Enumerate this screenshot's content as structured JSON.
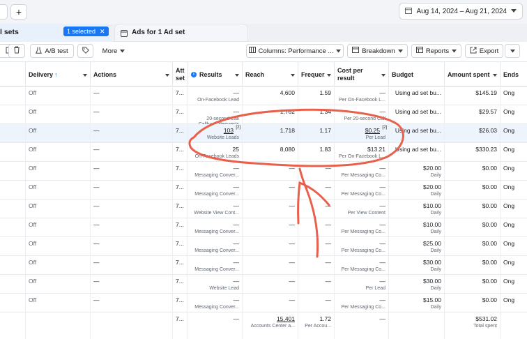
{
  "top": {
    "add_btn": "+",
    "date_range": "Aug 14, 2024 – Aug 21, 2024"
  },
  "tabs": {
    "adsets_label": "l sets",
    "selected_badge": "1 selected",
    "selected_close": "✕",
    "ads_label": "Ads for 1 Ad set"
  },
  "toolbar": {
    "ab_test": "A/B test",
    "more": "More",
    "columns": "Columns: Performance ...",
    "breakdown": "Breakdown",
    "reports": "Reports",
    "export": "Export"
  },
  "headers": {
    "delivery": "Delivery",
    "actions": "Actions",
    "attr": "Att set",
    "results": "Results",
    "reach": "Reach",
    "frequency": "Frequer",
    "cpr": "Cost per result",
    "budget": "Budget",
    "amount_spent": "Amount spent",
    "ends": "Ends"
  },
  "rows": [
    {
      "delivery": "Off",
      "actions": "—",
      "attr": "7...",
      "results": "—",
      "results_sub": "On-Facebook Lead",
      "reach": "4,600",
      "freq": "1.59",
      "cpr": "—",
      "cpr_sub": "Per On-Facebook L...",
      "budget": "Using ad set bu...",
      "budget_sub": "",
      "spent": "$145.19",
      "ends": "Ong"
    },
    {
      "delivery": "Off",
      "actions": "—",
      "attr": "7...",
      "results": "—",
      "results_sub": "20-second Call",
      "results_sub2": "Callback Requests",
      "reach": "1,762",
      "freq": "1.34",
      "cpr": "—",
      "cpr_sub": "Per 20-second Call",
      "budget": "Using ad set bu...",
      "budget_sub": "",
      "spent": "$29.57",
      "ends": "Ong"
    },
    {
      "delivery": "Off",
      "actions": "—",
      "attr": "7...",
      "results": "103",
      "results_badge": "[2]",
      "results_sub": "Website Leads",
      "reach": "1,718",
      "freq": "1.17",
      "cpr": "$0.25",
      "cpr_badge": "[2]",
      "cpr_sub": "Per Lead",
      "budget": "Using ad set bu...",
      "budget_sub": "",
      "spent": "$26.03",
      "ends": "Ong"
    },
    {
      "delivery": "Off",
      "actions": "—",
      "attr": "7...",
      "results": "25",
      "results_sub": "On-Facebook Leads",
      "reach": "8,080",
      "freq": "1.83",
      "cpr": "$13.21",
      "cpr_sub": "Per On-Facebook L...",
      "budget": "Using ad set bu...",
      "budget_sub": "",
      "spent": "$330.23",
      "ends": "Ong"
    },
    {
      "delivery": "Off",
      "actions": "—",
      "attr": "7...",
      "results": "—",
      "results_sub": "Messaging Conver...",
      "reach": "—",
      "freq": "—",
      "cpr": "—",
      "cpr_sub": "Per Messaging Co...",
      "budget": "$20.00",
      "budget_sub": "Daily",
      "spent": "$0.00",
      "ends": "Ong"
    },
    {
      "delivery": "Off",
      "actions": "—",
      "attr": "7...",
      "results": "—",
      "results_sub": "Messaging Conver...",
      "reach": "—",
      "freq": "—",
      "cpr": "—",
      "cpr_sub": "Per Messaging Co...",
      "budget": "$20.00",
      "budget_sub": "Daily",
      "spent": "$0.00",
      "ends": "Ong"
    },
    {
      "delivery": "Off",
      "actions": "—",
      "attr": "7...",
      "results": "—",
      "results_sub": "Website View Cont...",
      "reach": "—",
      "freq": "—",
      "cpr": "—",
      "cpr_sub": "Per View Content",
      "budget": "$10.00",
      "budget_sub": "Daily",
      "spent": "$0.00",
      "ends": "Ong"
    },
    {
      "delivery": "Off",
      "actions": "—",
      "attr": "7...",
      "results": "—",
      "results_sub": "Messaging Conver...",
      "reach": "—",
      "freq": "—",
      "cpr": "—",
      "cpr_sub": "Per Messaging Co...",
      "budget": "$10.00",
      "budget_sub": "Daily",
      "spent": "$0.00",
      "ends": "Ong"
    },
    {
      "delivery": "Off",
      "actions": "—",
      "attr": "7...",
      "results": "—",
      "results_sub": "Messaging Conver...",
      "reach": "—",
      "freq": "—",
      "cpr": "—",
      "cpr_sub": "Per Messaging Co...",
      "budget": "$25.00",
      "budget_sub": "Daily",
      "spent": "$0.00",
      "ends": "Ong"
    },
    {
      "delivery": "Off",
      "actions": "—",
      "attr": "7...",
      "results": "—",
      "results_sub": "Messaging Conver...",
      "reach": "—",
      "freq": "—",
      "cpr": "—",
      "cpr_sub": "Per Messaging Co...",
      "budget": "$30.00",
      "budget_sub": "Daily",
      "spent": "$0.00",
      "ends": "Ong"
    },
    {
      "delivery": "Off",
      "actions": "—",
      "attr": "7...",
      "results": "—",
      "results_sub": "Website Lead",
      "reach": "—",
      "freq": "—",
      "cpr": "—",
      "cpr_sub": "Per Lead",
      "budget": "$30.00",
      "budget_sub": "Daily",
      "spent": "$0.00",
      "ends": "Ong"
    },
    {
      "delivery": "Off",
      "actions": "—",
      "attr": "7...",
      "results": "—",
      "results_sub": "Messaging Conver...",
      "reach": "—",
      "freq": "—",
      "cpr": "—",
      "cpr_sub": "Per Messaging Co...",
      "budget": "$15.00",
      "budget_sub": "Daily",
      "spent": "$0.00",
      "ends": "Ong"
    }
  ],
  "totals": {
    "attr": "7...",
    "results": "—",
    "reach": "15,401",
    "reach_sub": "Accounts Center a...",
    "freq": "1.72",
    "freq_sub": "Per Accou...",
    "cpr": "—",
    "spent": "$531.02",
    "spent_sub": "Total spent"
  },
  "colors": {
    "accent": "#1877f2",
    "annotation": "#e8604c"
  }
}
